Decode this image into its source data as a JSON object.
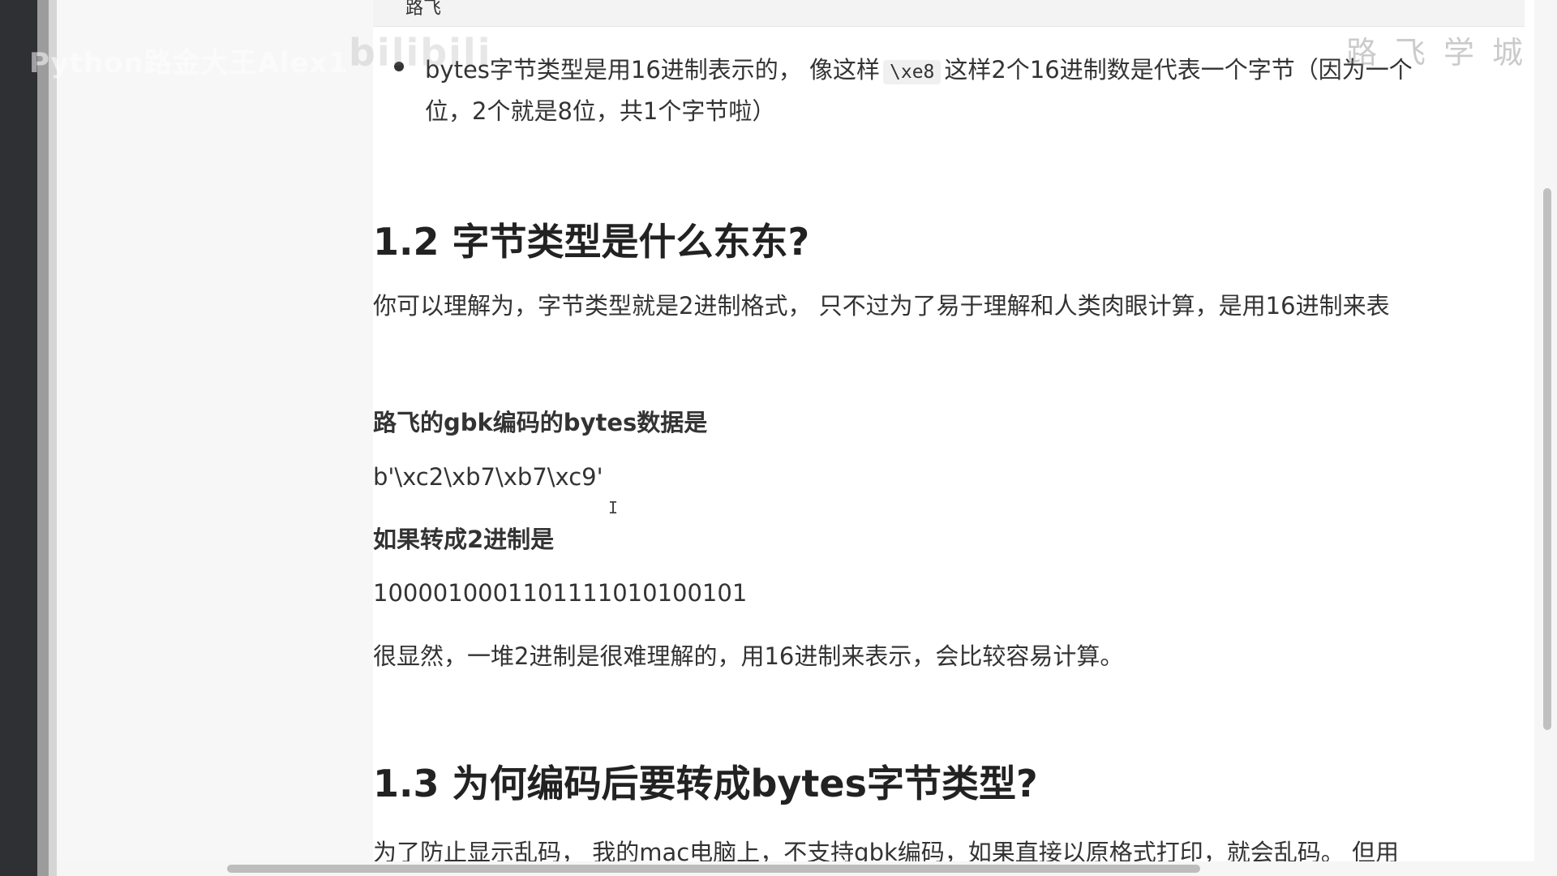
{
  "watermark": {
    "channel": "Python路金大王Alex1",
    "site": "bilibili",
    "brand": "路飞学城"
  },
  "code_top_text": "路飞",
  "bullet": {
    "text_before": "bytes字节类型是用16进制表示的， 像这样",
    "code": "\\xe8",
    "text_after": "这样2个16进制数是代表一个字节（因为一个",
    "line2": "位，2个就是8位，共1个字节啦）"
  },
  "section_1_2": {
    "heading": "1.2 字节类型是什么东东?",
    "intro": "你可以理解为，字节类型就是2进制格式， 只不过为了易于理解和人类肉眼计算，是用16进制来表",
    "gbk_label": "路飞的gbk编码的bytes数据是",
    "gbk_value": "b'\\xc2\\xb7\\xb7\\xc9'",
    "binary_label": "如果转成2进制是",
    "binary_value": "100001000110111101010010​1",
    "conclusion": "很显然，一堆2进制是很难理解的，用16进制来表示，会比较容易计算。"
  },
  "section_1_3": {
    "heading": "1.3 为何编码后要转成bytes字节类型?",
    "intro": "为了防止显示乱码， 我的mac电脑上，不支持gbk编码，如果直接以原格式打印，就会乱码。 但用"
  },
  "cursor": "I"
}
